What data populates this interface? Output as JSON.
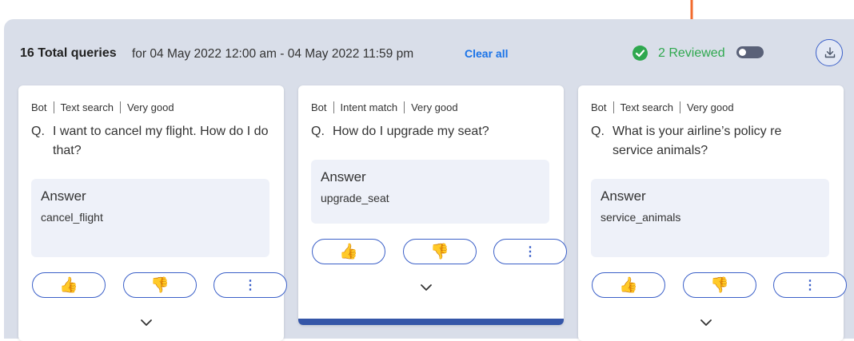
{
  "header": {
    "total": "16 Total queries",
    "daterange": "for 04 May 2022 12:00 am - 04 May 2022 11:59 pm",
    "clear_all": "Clear all",
    "reviewed": "2 Reviewed"
  },
  "colors": {
    "accent": "#3a5fc8",
    "reviewed_green": "#2fa84f",
    "annotation_arrow": "#f26b2e"
  },
  "cards": [
    {
      "source": "Bot",
      "match": "Text search",
      "rating": "Very good",
      "q_prefix": "Q.",
      "question": "I want to cancel my flight. How do I do that?",
      "answer_title": "Answer",
      "answer": "cancel_flight",
      "like_icon": "👍",
      "dislike_icon": "👎",
      "more_icon": "⋮"
    },
    {
      "source": "Bot",
      "match": "Intent match",
      "rating": "Very good",
      "q_prefix": "Q.",
      "question": "How do I upgrade my seat?",
      "answer_title": "Answer",
      "answer": "upgrade_seat",
      "like_icon": "👍",
      "dislike_icon": "👎",
      "more_icon": "⋮"
    },
    {
      "source": "Bot",
      "match": "Text search",
      "rating": "Very good",
      "q_prefix": "Q.",
      "question": "What is your airline’s policy re service animals?",
      "answer_title": "Answer",
      "answer": "service_animals",
      "like_icon": "👍",
      "dislike_icon": "👎",
      "more_icon": "⋮"
    }
  ]
}
